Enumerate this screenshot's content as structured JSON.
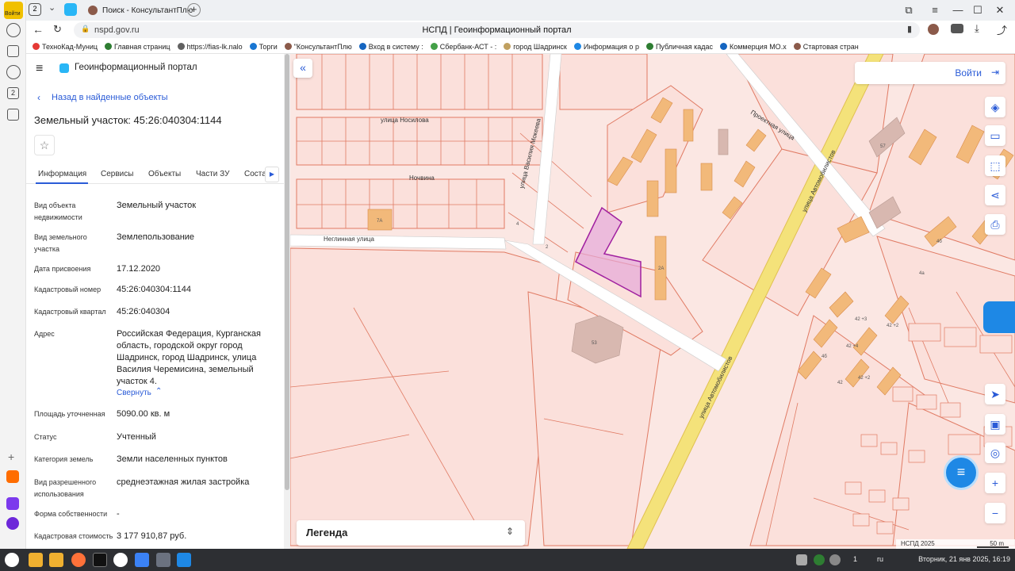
{
  "browser": {
    "tab_count": "2",
    "tabs": [
      {
        "label": "Поиск - КонсультантПлю"
      },
      {
        "label": "НСПД | Геоинформационный портал"
      }
    ],
    "url": "nspd.gov.ru",
    "page_title": "НСПД | Геоинформационный портал",
    "profile_label": "Войти",
    "bookmarks": [
      {
        "label": "ТехноКад-Муниц",
        "color": "#e53935"
      },
      {
        "label": "Главная страниц",
        "color": "#2e7d32"
      },
      {
        "label": "https://fias-lk.nalo",
        "color": "#616161"
      },
      {
        "label": "Торги",
        "color": "#1976d2"
      },
      {
        "label": "\"КонсультантПлю",
        "color": "#8b5a4a"
      },
      {
        "label": "Вход в систему :",
        "color": "#1565c0"
      },
      {
        "label": "Сбербанк-АСТ - :",
        "color": "#43a047"
      },
      {
        "label": "город Шадринск",
        "color": "#c0a060"
      },
      {
        "label": "Информация о р",
        "color": "#1e88e5"
      },
      {
        "label": "Публичная кадас",
        "color": "#2e7d32"
      },
      {
        "label": "Коммерция МО.х",
        "color": "#1565c0"
      },
      {
        "label": "Стартовая стран",
        "color": "#8b5a4a"
      }
    ]
  },
  "portal": {
    "title": "Геоинформационный портал",
    "back_link": "Назад в найденные объекты",
    "object_title": "Земельный участок: 45:26:040304:1144",
    "tabs": [
      "Информация",
      "Сервисы",
      "Объекты",
      "Части ЗУ",
      "Соста"
    ],
    "fields": [
      {
        "label": "Вид объекта недвижимости",
        "value": "Земельный участок"
      },
      {
        "label": "Вид земельного участка",
        "value": "Землепользование"
      },
      {
        "label": "Дата присвоения",
        "value": "17.12.2020"
      },
      {
        "label": "Кадастровый номер",
        "value": "45:26:040304:1144"
      },
      {
        "label": "Кадастровый квартал",
        "value": "45:26:040304"
      },
      {
        "label": "Адрес",
        "value": "Российская Федерация, Курганская область, городской округ город Шадринск, город Шадринск, улица Василия Черемисина, земельный участок 4."
      },
      {
        "label": "Площадь уточненная",
        "value": "5090.00 кв. м"
      },
      {
        "label": "Статус",
        "value": "Учтенный"
      },
      {
        "label": "Категория земель",
        "value": "Земли населенных пунктов"
      },
      {
        "label": "Вид разрешенного использования",
        "value": "среднеэтажная жилая застройка"
      },
      {
        "label": "Форма собственности",
        "value": "-"
      },
      {
        "label": "Кадастровая стоимость",
        "value": "3 177 910,87 руб."
      }
    ],
    "collapse_link": "Свернуть"
  },
  "map": {
    "login": "Войти",
    "legend": "Легенда",
    "attribution": "НСПД 2025",
    "scale": "50 m",
    "streets": {
      "nosilova": "улица Носилова",
      "nochvina": "Ночвина",
      "neglinnaya": "Неглинная улица",
      "mokeeva": "улица Василия Мокеева",
      "proektnaya": "Проектная улица",
      "avtomobilistov1": "улица Автомобилистов",
      "avtomobilistov2": "улица Автомобилистов"
    },
    "house_numbers": [
      "7А",
      "4",
      "2А",
      "53",
      "57",
      "4б",
      "4а",
      "42 +3",
      "42 +2",
      "42 +4",
      "4б",
      "42",
      "42 +2",
      "2"
    ],
    "accent": "#2a5bd7",
    "parcel_fill": "#fbe0db",
    "parcel_line": "#e07a63",
    "selected": "#a020a0",
    "road": "#f4e27a"
  },
  "taskbar": {
    "clock": "Вторник, 21 янв 2025, 16:19",
    "lang": "ru",
    "count": "1"
  }
}
